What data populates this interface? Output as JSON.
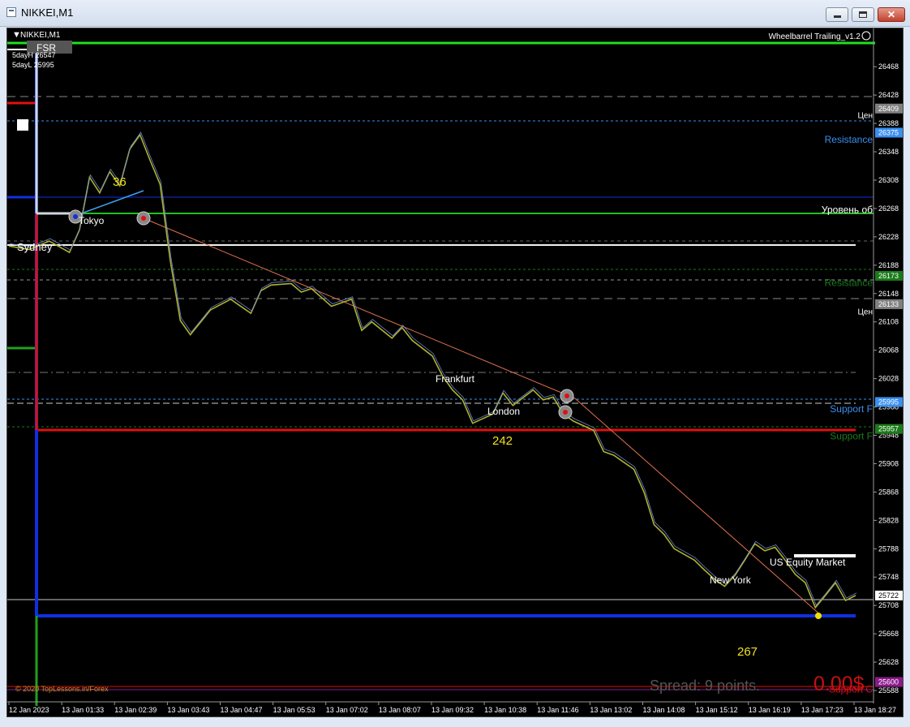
{
  "window": {
    "title": "NIKKEI,M1"
  },
  "chart_header": {
    "symbol": "NIKKEI,M1",
    "five_day_high": "5dayH 26547",
    "five_day_low": "5dayL 25995",
    "fsr_label": "FSR",
    "indicator_name": "Wheelbarrel Trailing_v1.2",
    "copyright": "© 2020 TopLessons.in/Forex"
  },
  "colors": {
    "background": "#000000",
    "price_line": "#b0b030",
    "support_red": "#e01010",
    "green_level": "#20c020",
    "blue_level": "#1030e0",
    "resistance_blue": "#3a8ff0",
    "trendline": "#e07050"
  },
  "chart_data": {
    "type": "line",
    "y_axis_ticks": [
      "26468",
      "26428",
      "26388",
      "26348",
      "26308",
      "26268",
      "26228",
      "26188",
      "26148",
      "26108",
      "26068",
      "26028",
      "25988",
      "25948",
      "25908",
      "25868",
      "25828",
      "25788",
      "25748",
      "25708",
      "25668",
      "25628",
      "25588"
    ],
    "x_axis_ticks": [
      "12 Jan 2023",
      "13 Jan 01:33",
      "13 Jan 02:39",
      "13 Jan 03:43",
      "13 Jan 04:47",
      "13 Jan 05:53",
      "13 Jan 07:02",
      "13 Jan 08:07",
      "13 Jan 09:32",
      "13 Jan 10:38",
      "13 Jan 11:46",
      "13 Jan 13:02",
      "13 Jan 14:08",
      "13 Jan 15:12",
      "13 Jan 16:19",
      "13 Jan 17:23",
      "13 Jan 18:27"
    ],
    "ylim": [
      25580,
      26490
    ],
    "series": [
      {
        "points": [
          [
            0,
            26215
          ],
          [
            2,
            26210
          ],
          [
            4,
            26222
          ],
          [
            6,
            26206
          ],
          [
            7,
            26238
          ],
          [
            8,
            26312
          ],
          [
            9,
            26290
          ],
          [
            10,
            26320
          ],
          [
            11,
            26300
          ],
          [
            12,
            26352
          ],
          [
            13,
            26372
          ],
          [
            14,
            26336
          ],
          [
            15,
            26302
          ],
          [
            16,
            26195
          ],
          [
            17,
            26110
          ],
          [
            18,
            26090
          ],
          [
            20,
            26125
          ],
          [
            22,
            26140
          ],
          [
            24,
            26120
          ],
          [
            25,
            26152
          ],
          [
            26,
            26160
          ],
          [
            28,
            26162
          ],
          [
            29,
            26150
          ],
          [
            30,
            26155
          ],
          [
            32,
            26130
          ],
          [
            34,
            26140
          ],
          [
            35,
            26096
          ],
          [
            36,
            26108
          ],
          [
            38,
            26085
          ],
          [
            39,
            26100
          ],
          [
            40,
            26082
          ],
          [
            42,
            26060
          ],
          [
            43,
            26032
          ],
          [
            44,
            26012
          ],
          [
            45,
            25998
          ],
          [
            46,
            25965
          ],
          [
            48,
            25978
          ],
          [
            49,
            26008
          ],
          [
            50,
            25990
          ],
          [
            52,
            26012
          ],
          [
            53,
            25998
          ],
          [
            54,
            26002
          ],
          [
            55,
            25978
          ],
          [
            56,
            25968
          ],
          [
            58,
            25955
          ],
          [
            59,
            25925
          ],
          [
            60,
            25920
          ],
          [
            61,
            25910
          ],
          [
            62,
            25900
          ],
          [
            63,
            25868
          ],
          [
            64,
            25822
          ],
          [
            65,
            25808
          ],
          [
            66,
            25788
          ],
          [
            67,
            25780
          ],
          [
            68,
            25772
          ],
          [
            69,
            25758
          ],
          [
            70,
            25745
          ],
          [
            71,
            25735
          ],
          [
            72,
            25750
          ],
          [
            73,
            25772
          ],
          [
            74,
            25795
          ],
          [
            75,
            25785
          ],
          [
            76,
            25790
          ],
          [
            77,
            25772
          ],
          [
            78,
            25752
          ],
          [
            79,
            25740
          ],
          [
            80,
            25705
          ],
          [
            81,
            25722
          ],
          [
            82,
            25740
          ],
          [
            83,
            25715
          ],
          [
            84,
            25722
          ]
        ]
      }
    ],
    "price_axis_tags": [
      {
        "text": "26409",
        "value": 26409,
        "color": "#808080"
      },
      {
        "text": "26375",
        "value": 26375,
        "color": "#3a8ff0"
      },
      {
        "text": "26173",
        "value": 26173,
        "color": "#1a7a1a"
      },
      {
        "text": "26133",
        "value": 26133,
        "color": "#808080"
      },
      {
        "text": "25995",
        "value": 25995,
        "color": "#3a8ff0"
      },
      {
        "text": "25957",
        "value": 25957,
        "color": "#1a7a1a"
      },
      {
        "text": "25722",
        "value": 25722,
        "color": "#ffffff"
      },
      {
        "text": "25600",
        "value": 25600,
        "color": "#8a1a8a"
      }
    ],
    "right_labels": [
      {
        "text": "Цен",
        "value": 26400,
        "color": "#ffffff"
      },
      {
        "text": "Resistance",
        "value": 26365,
        "color": "#3a8ff0"
      },
      {
        "text": "Уровень об",
        "value": 26266,
        "color": "#ffffff"
      },
      {
        "text": "Resistance",
        "value": 26163,
        "color": "#1a7a1a"
      },
      {
        "text": "Цен",
        "value": 26123,
        "color": "#ffffff"
      },
      {
        "text": "Support F",
        "value": 25985,
        "color": "#3a8ff0"
      },
      {
        "text": "Support F",
        "value": 25947,
        "color": "#1a7a1a"
      },
      {
        "text": "Support C",
        "value": 25590,
        "color": "#e01010"
      }
    ],
    "session_labels": [
      "Tokyo",
      "Sydney",
      "Frankfurt",
      "London",
      "New York",
      "US Equity Market"
    ],
    "pip_labels": [
      "36",
      "242",
      "267"
    ],
    "spread_text": "Spread: 9 points.",
    "profit_text": "0.00$"
  }
}
